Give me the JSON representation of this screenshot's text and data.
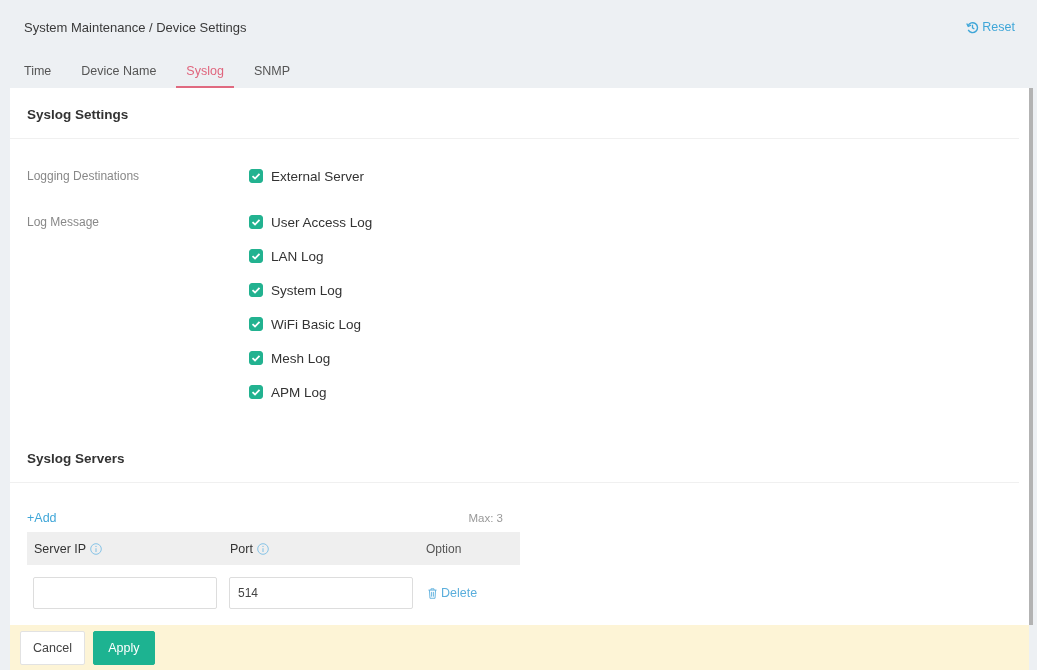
{
  "header": {
    "breadcrumb": "System Maintenance / Device Settings",
    "reset": "Reset"
  },
  "tabs": [
    {
      "label": "Time",
      "selected": false
    },
    {
      "label": "Device Name",
      "selected": false
    },
    {
      "label": "Syslog",
      "selected": true
    },
    {
      "label": "SNMP",
      "selected": false
    }
  ],
  "syslog_settings": {
    "title": "Syslog Settings",
    "groups": [
      {
        "label": "Logging Destinations",
        "options": [
          {
            "label": "External Server",
            "checked": true
          }
        ]
      },
      {
        "label": "Log Message",
        "options": [
          {
            "label": "User Access Log",
            "checked": true
          },
          {
            "label": "LAN Log",
            "checked": true
          },
          {
            "label": "System Log",
            "checked": true
          },
          {
            "label": "WiFi Basic Log",
            "checked": true
          },
          {
            "label": "Mesh Log",
            "checked": true
          },
          {
            "label": "APM Log",
            "checked": true
          }
        ]
      }
    ]
  },
  "syslog_servers": {
    "title": "Syslog Servers",
    "add": "+Add",
    "limit": "Max: 3",
    "table": {
      "columns": [
        {
          "label": "Server IP",
          "info": true
        },
        {
          "label": "Port",
          "info": true
        },
        {
          "label": "Option",
          "info": false
        }
      ],
      "rows": [
        {
          "port": "514",
          "action": "Delete"
        }
      ]
    }
  },
  "footer": {
    "buttons": [
      {
        "label": "Cancel",
        "kind": "default"
      },
      {
        "label": "Apply",
        "kind": "primary"
      }
    ]
  }
}
